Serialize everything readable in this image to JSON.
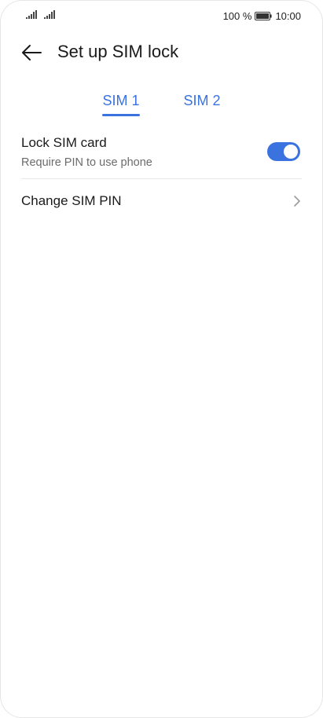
{
  "status_bar": {
    "battery_percent": "100 %",
    "time": "10:00",
    "icons": [
      "signal-icon",
      "signal-icon",
      "battery-icon"
    ]
  },
  "header": {
    "title": "Set up SIM lock",
    "back_icon": "arrow-left-icon"
  },
  "tabs": [
    {
      "label": "SIM 1",
      "selected": true
    },
    {
      "label": "SIM 2",
      "selected": false
    }
  ],
  "settings": {
    "lock_sim": {
      "title": "Lock SIM card",
      "subtitle": "Require PIN to use phone",
      "enabled": true
    },
    "change_pin": {
      "title": "Change SIM PIN",
      "icon": "chevron-right-icon"
    }
  },
  "colors": {
    "accent": "#3a72e0",
    "text_primary": "#1a1a1a",
    "text_secondary": "#6b6b6b",
    "divider": "#e8e8e8"
  }
}
